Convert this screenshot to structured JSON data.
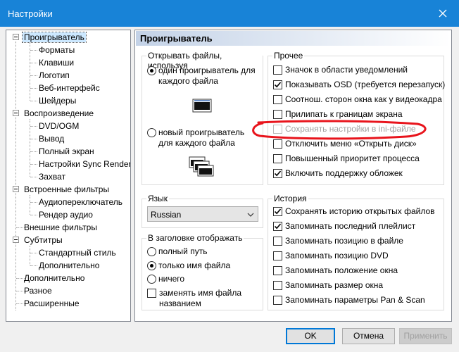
{
  "window": {
    "title": "Настройки"
  },
  "tree": {
    "items": [
      {
        "label": "Проигрыватель",
        "selected": true
      },
      {
        "label": "Форматы"
      },
      {
        "label": "Клавиши"
      },
      {
        "label": "Логотип"
      },
      {
        "label": "Веб-интерфейс"
      },
      {
        "label": "Шейдеры"
      },
      {
        "label": "Воспроизведение"
      },
      {
        "label": "DVD/OGM"
      },
      {
        "label": "Вывод"
      },
      {
        "label": "Полный экран"
      },
      {
        "label": "Настройки Sync Render"
      },
      {
        "label": "Захват"
      },
      {
        "label": "Встроенные фильтры"
      },
      {
        "label": "Аудиопереключатель"
      },
      {
        "label": "Рендер аудио"
      },
      {
        "label": "Внешние фильтры"
      },
      {
        "label": "Субтитры"
      },
      {
        "label": "Стандартный стиль"
      },
      {
        "label": "Дополнительно"
      },
      {
        "label": "Дополнительно"
      },
      {
        "label": "Разное"
      },
      {
        "label": "Расширенные"
      }
    ]
  },
  "panel": {
    "header": "Проигрыватель",
    "open_files": {
      "title": "Открывать файлы, используя",
      "one_player": "один проигрыватель для каждого файла",
      "new_player": "новый проигрыватель для каждого файла",
      "selected": "one_player"
    },
    "language": {
      "title": "Язык",
      "value": "Russian"
    },
    "title_bar": {
      "title": "В заголовке отображать",
      "full_path": "полный путь",
      "file_name_only": "только имя файла",
      "nothing": "ничего",
      "replace_with_title": "заменять имя файла названием",
      "selected": "file_name_only"
    },
    "other": {
      "title": "Прочее",
      "items": [
        {
          "label": "Значок в области уведомлений",
          "checked": false
        },
        {
          "label": "Показывать OSD (требуется перезапуск)",
          "checked": true
        },
        {
          "label": "Соотнош. сторон окна как у видеокадра",
          "checked": false
        },
        {
          "label": "Прилипать к границам экрана",
          "checked": false
        },
        {
          "label": "Сохранять настройки в ini-файле",
          "checked": false,
          "disabled": true
        },
        {
          "label": "Отключить меню «Открыть диск»",
          "checked": false
        },
        {
          "label": "Повышенный приоритет процесса",
          "checked": false
        },
        {
          "label": "Включить поддержку обложек",
          "checked": true
        }
      ]
    },
    "history": {
      "title": "История",
      "items": [
        {
          "label": "Сохранять историю открытых файлов",
          "checked": true
        },
        {
          "label": "Запоминать последний плейлист",
          "checked": true
        },
        {
          "label": "Запоминать позицию в файле",
          "checked": false
        },
        {
          "label": "Запоминать позицию DVD",
          "checked": false
        },
        {
          "label": "Запоминать положение окна",
          "checked": false
        },
        {
          "label": "Запоминать размер окна",
          "checked": false
        },
        {
          "label": "Запоминать параметры Pan & Scan",
          "checked": false
        }
      ]
    }
  },
  "buttons": {
    "ok": "OK",
    "cancel": "Отмена",
    "apply": "Применить"
  },
  "annotation": {
    "color": "#e8141c"
  }
}
